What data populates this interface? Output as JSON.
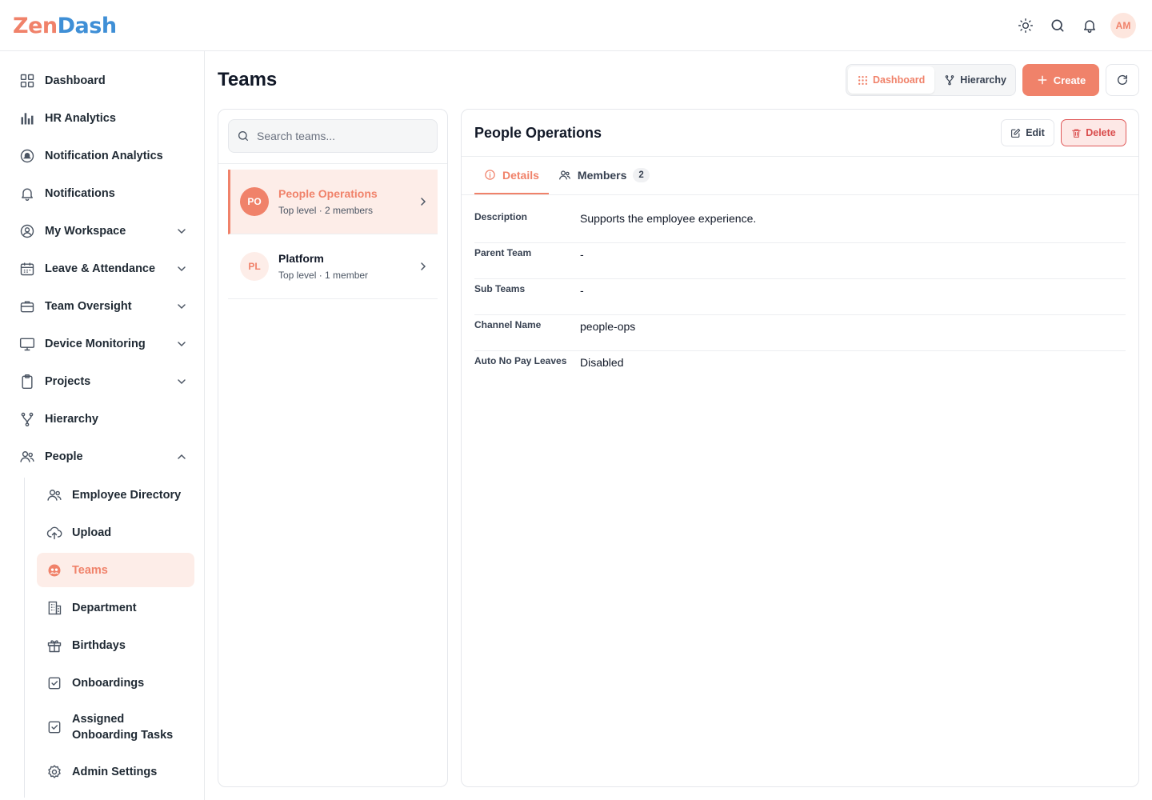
{
  "app": {
    "logo_part1": "Zen",
    "logo_part2": "Dash",
    "user_initials": "AM"
  },
  "colors": {
    "accent": "#f0826a",
    "danger": "#d94b4b",
    "logo_blue": "#3f8fd6"
  },
  "header_icons": [
    "sun-icon",
    "search-icon",
    "bell-icon"
  ],
  "sidebar": {
    "items": [
      {
        "label": "Dashboard",
        "icon": "grid-icon"
      },
      {
        "label": "HR Analytics",
        "icon": "bar-chart-icon"
      },
      {
        "label": "Notification Analytics",
        "icon": "notification-chart-icon"
      },
      {
        "label": "Notifications",
        "icon": "bell-icon"
      },
      {
        "label": "My Workspace",
        "icon": "user-circle-icon",
        "expandable": true
      },
      {
        "label": "Leave & Attendance",
        "icon": "calendar-icon",
        "expandable": true
      },
      {
        "label": "Team Oversight",
        "icon": "briefcase-icon",
        "expandable": true
      },
      {
        "label": "Device Monitoring",
        "icon": "monitor-icon",
        "expandable": true
      },
      {
        "label": "Projects",
        "icon": "clipboard-icon",
        "expandable": true
      },
      {
        "label": "Hierarchy",
        "icon": "hierarchy-icon"
      },
      {
        "label": "People",
        "icon": "users-icon",
        "expanded": true
      }
    ],
    "people_sub": [
      {
        "label": "Employee Directory",
        "icon": "users-icon"
      },
      {
        "label": "Upload",
        "icon": "cloud-upload-icon"
      },
      {
        "label": "Teams",
        "icon": "teams-icon",
        "active": true
      },
      {
        "label": "Department",
        "icon": "building-icon"
      },
      {
        "label": "Birthdays",
        "icon": "gift-icon"
      },
      {
        "label": "Onboardings",
        "icon": "checkbox-icon"
      },
      {
        "label": "Assigned Onboarding Tasks",
        "label_line1": "Assigned",
        "label_line2": "Onboarding Tasks",
        "icon": "checkbox-icon"
      },
      {
        "label": "Admin Settings",
        "icon": "gear-icon"
      }
    ]
  },
  "page": {
    "title": "Teams",
    "view_toggle": {
      "dashboard": "Dashboard",
      "hierarchy": "Hierarchy",
      "active": "Dashboard"
    },
    "create_label": "Create"
  },
  "teams_list": {
    "search_placeholder": "Search teams...",
    "teams": [
      {
        "initials": "PO",
        "name": "People Operations",
        "meta": "Top level · 2 members",
        "active": true
      },
      {
        "initials": "PL",
        "name": "Platform",
        "meta": "Top level · 1 member",
        "active": false
      }
    ]
  },
  "detail": {
    "title": "People Operations",
    "edit_label": "Edit",
    "delete_label": "Delete",
    "tabs": [
      {
        "label": "Details",
        "active": true
      },
      {
        "label": "Members",
        "count": "2"
      }
    ],
    "fields": [
      {
        "label": "Description",
        "value": "Supports the employee experience."
      },
      {
        "label": "Parent Team",
        "value": "-"
      },
      {
        "label": "Sub Teams",
        "value": "-"
      },
      {
        "label": "Channel Name",
        "value": "people-ops"
      },
      {
        "label": "Auto No Pay Leaves",
        "value": "Disabled"
      }
    ]
  }
}
